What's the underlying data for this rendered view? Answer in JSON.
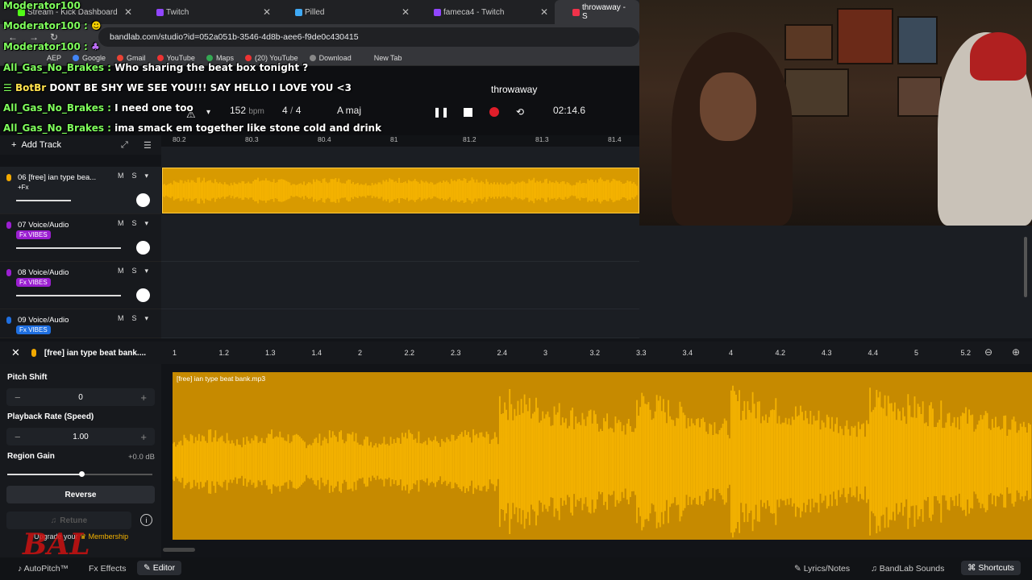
{
  "browser": {
    "tabs": [
      {
        "label": "Stream - Kick Dashboard",
        "close": "✕"
      },
      {
        "label": "Twitch",
        "close": "✕"
      },
      {
        "label": "Pilled",
        "close": "✕"
      },
      {
        "label": "fameca4 - Twitch",
        "close": "✕"
      },
      {
        "label": "throwaway - S",
        "close": ""
      }
    ],
    "url": "bandlab.com/studio?id=052a051b-3546-4d8b-aee6-f9de0c430415",
    "bookmarks": [
      "AEP",
      "Google",
      "Gmail",
      "YouTube",
      "Maps",
      "(20) YouTube",
      "Download",
      "New Tab"
    ]
  },
  "transport": {
    "project_title": "throwaway",
    "bpm": "152",
    "bpm_unit": "bpm",
    "time_sig_num": "4",
    "time_sig_sep": "/",
    "time_sig_den": "4",
    "key": "A maj",
    "time": "02:14.6"
  },
  "chat": [
    {
      "user": "Moderator100",
      "msg": ""
    },
    {
      "user": "Moderator100 :",
      "msg": ""
    },
    {
      "user": "Moderator100 :",
      "msg": ""
    },
    {
      "user": "All_Gas_No_Brakes :",
      "msg": "Who sharing the beat box tonight ?"
    },
    {
      "user": "BotBr",
      "msg": "DONT BE SHY WE SEE YOU!!! SAY HELLO I LOVE YOU <3"
    },
    {
      "user": "All_Gas_No_Brakes :",
      "msg": "I need one too"
    },
    {
      "user": "All_Gas_No_Brakes :",
      "msg": "ima smack em together like stone cold and drink"
    }
  ],
  "tracks": {
    "add_track": "Add Track",
    "ruler": [
      "80.2",
      "80.3",
      "80.4",
      "81",
      "81.2",
      "81.3",
      "81.4"
    ],
    "items": [
      {
        "name": "06  [free] ian type bea...",
        "fx": "+Fx",
        "m": "M",
        "s": "S"
      },
      {
        "name": "07  Voice/Audio",
        "fx": "Fx VIBES",
        "m": "M",
        "s": "S"
      },
      {
        "name": "08  Voice/Audio",
        "fx": "Fx VIBES",
        "m": "M",
        "s": "S"
      },
      {
        "name": "09  Voice/Audio",
        "fx": "Fx VIBES",
        "m": "M",
        "s": "S"
      }
    ]
  },
  "editor": {
    "clip_title": "[free] ian type beat bank....",
    "region_label": "[free] ian type beat bank.mp3",
    "ruler": [
      "1",
      "1.2",
      "1.3",
      "1.4",
      "2",
      "2.2",
      "2.3",
      "2.4",
      "3",
      "3.2",
      "3.3",
      "3.4",
      "4",
      "4.2",
      "4.3",
      "4.4",
      "5",
      "5.2"
    ],
    "pitch_label": "Pitch Shift",
    "pitch_value": "0",
    "rate_label": "Playback Rate (Speed)",
    "rate_value": "1.00",
    "gain_label": "Region Gain",
    "gain_value": "+0.0 dB",
    "gain_level": 0.51,
    "reverse_label": "Reverse",
    "retune_label": "Retune",
    "upgrade_text": "Upgrade your",
    "membership_text": "Membership"
  },
  "bottom": {
    "autopitch": "AutoPitch™",
    "effects": "Effects",
    "editor": "Editor",
    "lyrics": "Lyrics/Notes",
    "sounds": "BandLab Sounds",
    "shortcuts": "Shortcuts"
  },
  "watermark": "BAL",
  "colors": {
    "waveform": "#f5b300",
    "accent_record": "#e01e2a",
    "fx_badge": "#9b1fd1",
    "fx_badge_blue": "#1f6fe0"
  }
}
